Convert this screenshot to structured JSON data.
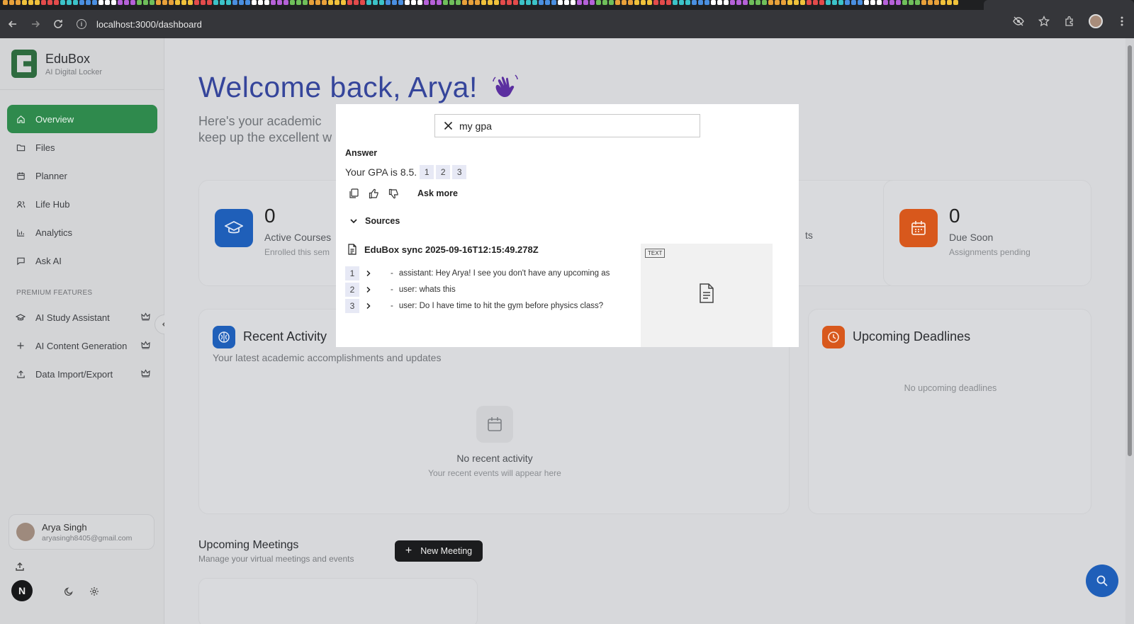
{
  "browser": {
    "url": "localhost:3000/dashboard"
  },
  "sidebar": {
    "brand_name": "EduBox",
    "brand_tagline": "AI Digital Locker",
    "nav": [
      {
        "label": "Overview",
        "icon": "home-icon"
      },
      {
        "label": "Files",
        "icon": "folder-icon"
      },
      {
        "label": "Planner",
        "icon": "calendar-icon"
      },
      {
        "label": "Life Hub",
        "icon": "users-icon"
      },
      {
        "label": "Analytics",
        "icon": "bar-chart-icon"
      },
      {
        "label": "Ask AI",
        "icon": "chat-icon"
      }
    ],
    "premium_label": "PREMIUM FEATURES",
    "premium": [
      {
        "label": "AI Study Assistant",
        "icon": "graduation-cap-icon"
      },
      {
        "label": "AI Content Generation",
        "icon": "plus-icon"
      },
      {
        "label": "Data Import/Export",
        "icon": "upload-icon"
      }
    ],
    "user": {
      "name": "Arya Singh",
      "email": "aryasingh8405@gmail.com"
    },
    "badge_letter": "N"
  },
  "main": {
    "welcome": "Welcome back, Arya!",
    "subtitle_line1": "Here's your academic",
    "subtitle_line2": "keep up the excellent w",
    "stats": [
      {
        "number": "0",
        "label": "Active Courses",
        "sub": "Enrolled this sem"
      },
      {
        "number": "0",
        "label": "Due Soon",
        "sub": "Assignments pending"
      }
    ],
    "stat_fragment": "ts",
    "recent_activity": {
      "title": "Recent Activity",
      "subtitle": "Your latest academic accomplishments and updates",
      "empty_title": "No recent activity",
      "empty_sub": "Your recent events will appear here"
    },
    "deadlines": {
      "title": "Upcoming Deadlines",
      "empty": "No upcoming deadlines"
    },
    "meetings": {
      "title": "Upcoming Meetings",
      "subtitle": "Manage your virtual meetings and events",
      "button": "New Meeting"
    }
  },
  "modal": {
    "query": "my gpa",
    "answer_heading": "Answer",
    "answer_text": "Your GPA is 8.5.",
    "citations": [
      "1",
      "2",
      "3"
    ],
    "ask_more": "Ask more",
    "sources_heading": "Sources",
    "source_title": "EduBox sync 2025-09-16T12:15:49.278Z",
    "source_rows": [
      {
        "num": "1",
        "text": "assistant: Hey Arya! I see you don't have any upcoming as"
      },
      {
        "num": "2",
        "text": "user: whats this"
      },
      {
        "num": "3",
        "text": "user: Do I have time to hit the gym before physics class?"
      }
    ],
    "preview_tag": "TEXT"
  },
  "colors": {
    "accent_green": "#2f8a4d",
    "brand_blue": "#35459b",
    "icon_blue": "#1f5fb9",
    "icon_orange": "#d8581c"
  }
}
